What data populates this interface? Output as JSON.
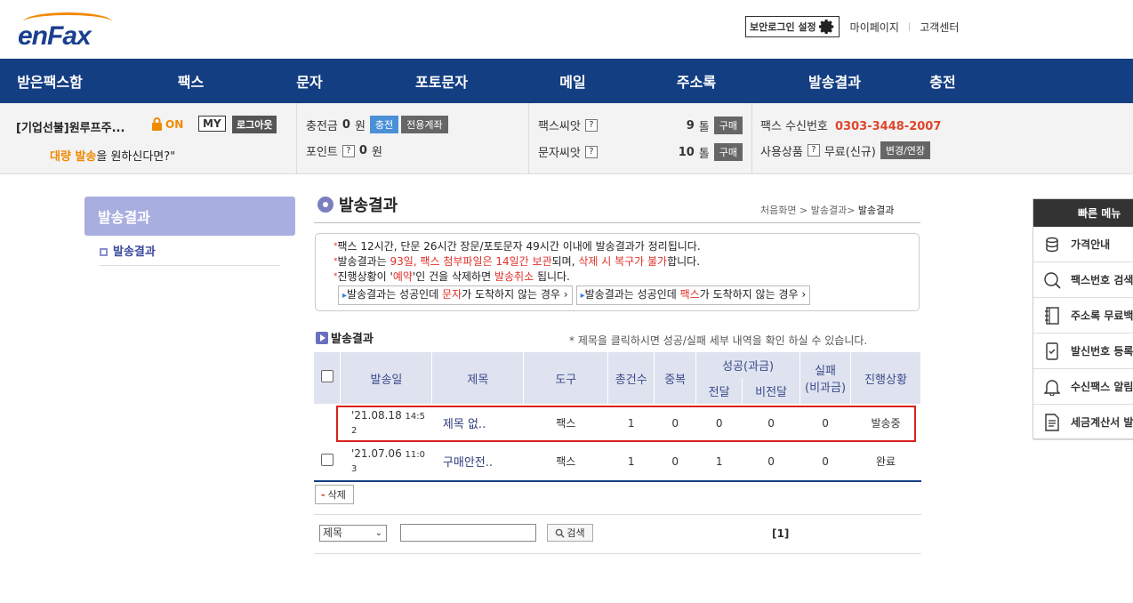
{
  "header": {
    "logo_text": "enFax",
    "secure_login_label": "보안로그인 설정",
    "mypage_label": "마이페이지",
    "support_label": "고객센터"
  },
  "nav": [
    "받은팩스함",
    "팩스",
    "문자",
    "포토문자",
    "메일",
    "주소록",
    "발송결과",
    "충전"
  ],
  "info": {
    "company": "[기업선불]원루프주...",
    "lock_status": "ON",
    "my_label": "MY",
    "logout_label": "로그아웃",
    "promo_highlight": "대량 발송",
    "promo_rest": "을 원하신다면?\"",
    "charge_label": "충전금",
    "charge_value": "0",
    "won": "원",
    "charge_button": "충전",
    "account_button": "전용계좌",
    "point_label": "포인트",
    "point_value": "0",
    "fax_seed_label": "팩스씨앗",
    "fax_seed_value": "9",
    "sms_seed_label": "문자씨앗",
    "sms_seed_value": "10",
    "seed_unit": "톨",
    "buy_button": "구매",
    "fax_number_label": "팩스 수신번호",
    "fax_number": "0303-3448-2007",
    "product_label": "사용상품",
    "product_value": "무료(신규)",
    "change_button": "변경/연장",
    "qmark": "?"
  },
  "sidebar": {
    "title": "발송결과",
    "item": "발송결과"
  },
  "main": {
    "title": "발송결과",
    "breadcrumb_home": "처음화면",
    "breadcrumb_mid": "발송결과",
    "breadcrumb_current": "발송결과",
    "notice": {
      "line1": "팩스 12시간, 단문 26시간 장문/포토문자 49시간 이내에 발송결과가 정리됩니다.",
      "line2_a": "발송결과는 ",
      "line2_b": "93일, 팩스 첨부파일은 14일간 보관",
      "line2_c": "되며, ",
      "line2_d": "삭제 시 복구가 불가",
      "line2_e": "합니다.",
      "line3_a": "진행상황이 '",
      "line3_b": "예약",
      "line3_c": "'인 건을 삭제하면 ",
      "line3_d": "발송취소",
      "line3_e": " 됩니다.",
      "btn1_a": "발송결과는 성공인데 ",
      "btn1_b": "문자",
      "btn1_c": "가 도착하지 않는 경우",
      "btn2_a": "발송결과는 성공인데 ",
      "btn2_b": "팩스",
      "btn2_c": "가 도착하지 않는 경우"
    },
    "section_title": "발송결과",
    "hint": "* 제목을 클릭하시면 성공/실패 세부 내역을 확인 하실 수 있습니다.",
    "columns": {
      "date": "발송일",
      "subject": "제목",
      "tool": "도구",
      "total": "총건수",
      "dup": "중복",
      "success": "성공(과금)",
      "delivered": "전달",
      "undelivered": "비전달",
      "fail": "실패",
      "fail_sub": "(비과금)",
      "status": "진행상황"
    },
    "rows": [
      {
        "date": "'21.08.18",
        "time_a": "14:5",
        "time_b": "2",
        "subject": "제목 없..",
        "tool": "팩스",
        "total": "1",
        "dup": "0",
        "delivered": "0",
        "undelivered": "0",
        "fail": "0",
        "status": "발송중"
      },
      {
        "date": "'21.07.06",
        "time_a": "11:0",
        "time_b": "3",
        "subject": "구매안전..",
        "tool": "팩스",
        "total": "1",
        "dup": "0",
        "delivered": "1",
        "undelivered": "0",
        "fail": "0",
        "status": "완료"
      }
    ],
    "delete_button": "삭제",
    "search_select": "제목",
    "search_button": "검색",
    "pagination": "[1]"
  },
  "quick_menu": {
    "title": "빠른 메뉴",
    "items": [
      "가격안내",
      "팩스번호 검색",
      "주소록 무료백업",
      "발신번호 등록",
      "수신팩스 알림",
      "세금계산서 발행"
    ]
  }
}
